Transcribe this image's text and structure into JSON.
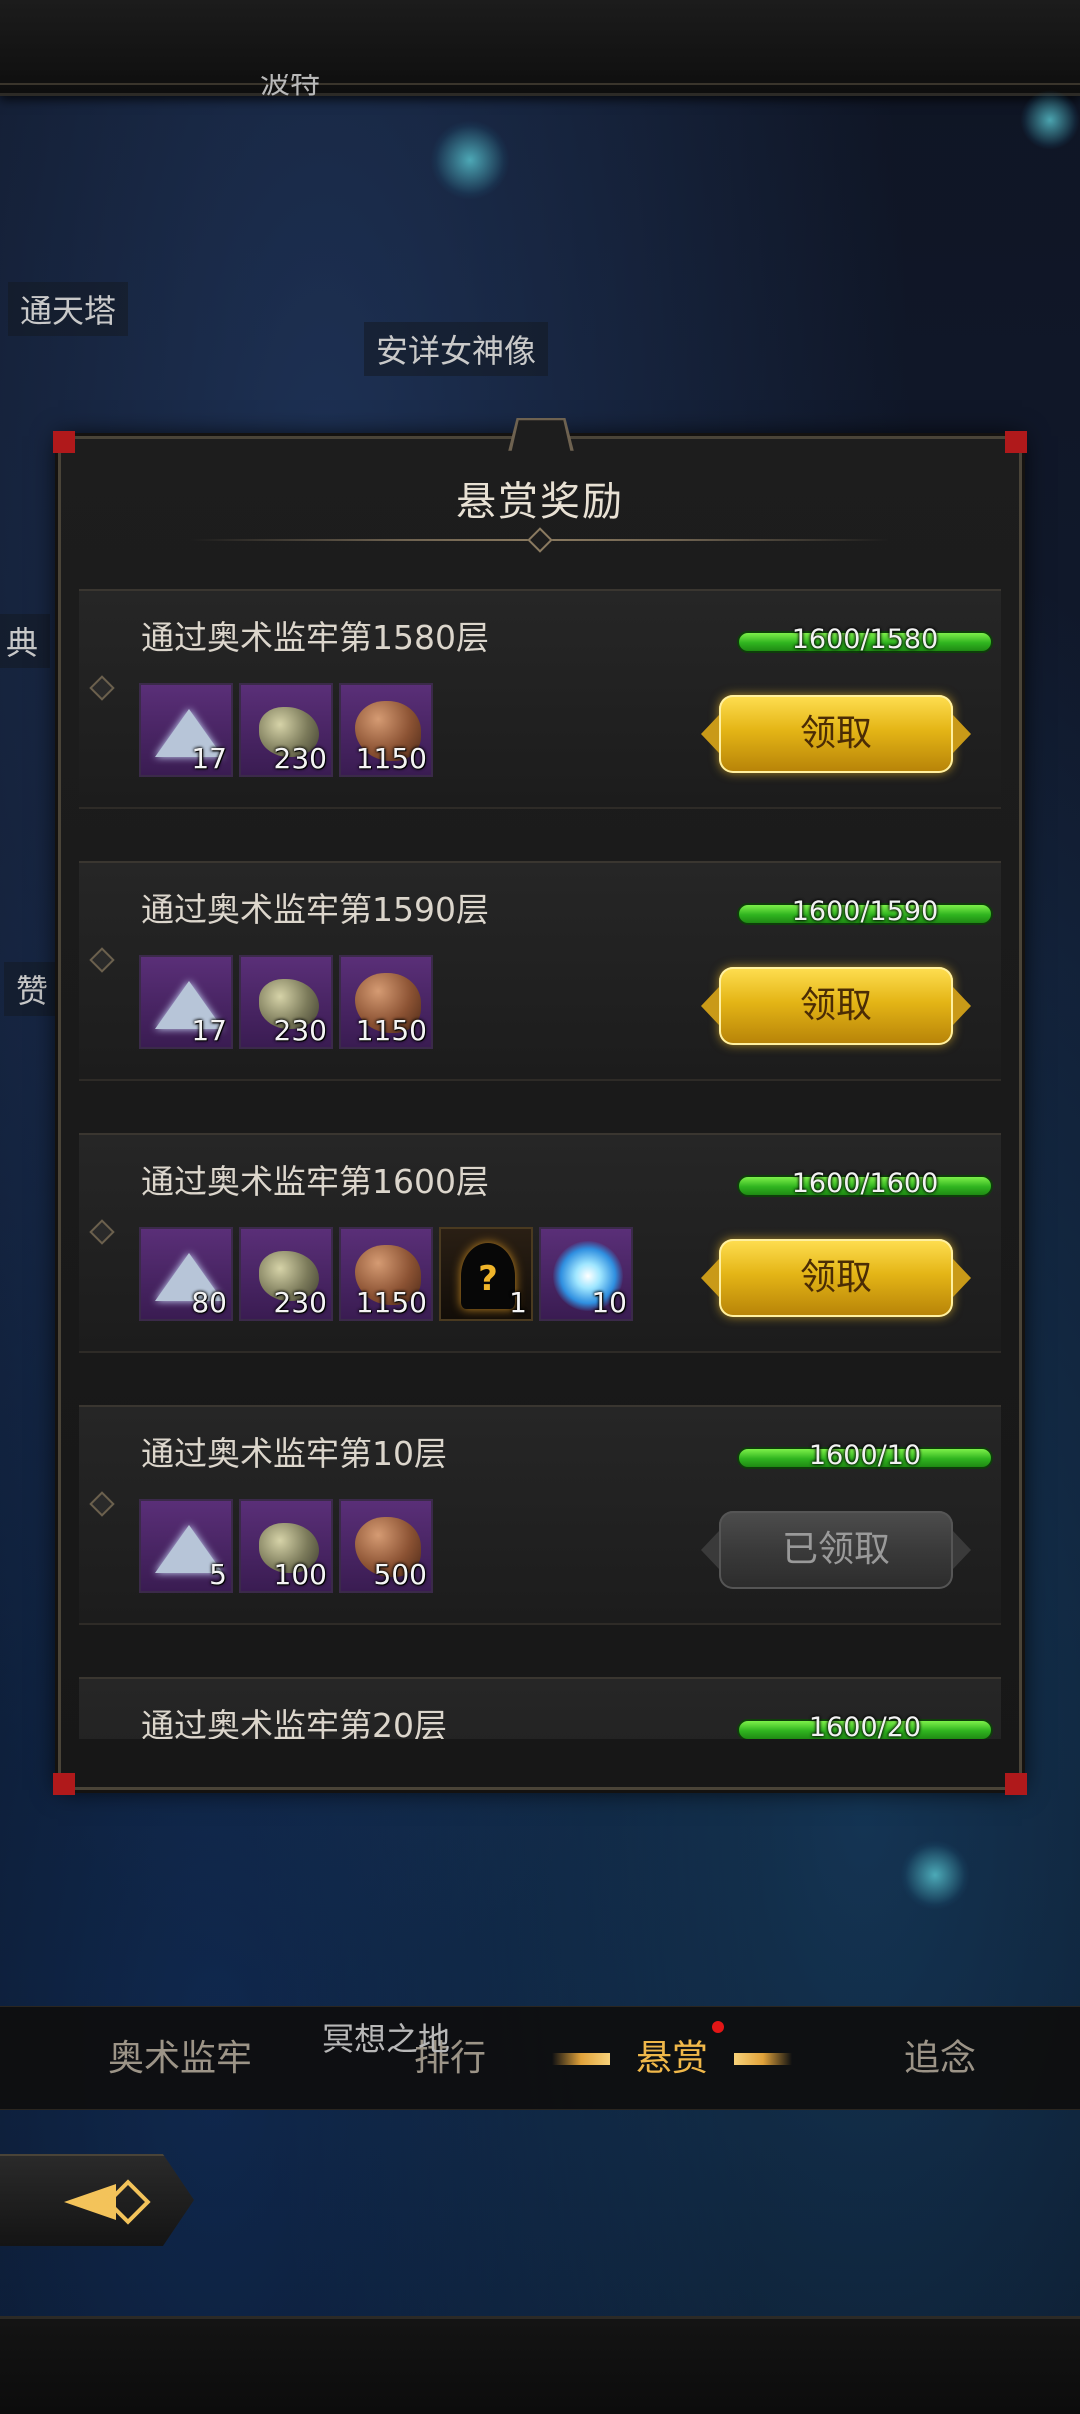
{
  "map_labels": {
    "top_cut": "波特",
    "tower": "通天塔",
    "goddess": "安详女神像",
    "left_edge_1": "典",
    "left_edge_2": "赞",
    "meditation": "冥想之地"
  },
  "panel": {
    "title": "悬赏奖励"
  },
  "quests": [
    {
      "title": "通过奥术监牢第1580层",
      "progress": {
        "current": 1600,
        "target": 1580,
        "label": "1600/1580"
      },
      "rewards": [
        {
          "icon": "crystal-shard-icon",
          "count": "17"
        },
        {
          "icon": "ore-icon",
          "count": "230"
        },
        {
          "icon": "copper-rock-icon",
          "count": "1150"
        }
      ],
      "action": "领取",
      "claimed": false
    },
    {
      "title": "通过奥术监牢第1590层",
      "progress": {
        "current": 1600,
        "target": 1590,
        "label": "1600/1590"
      },
      "rewards": [
        {
          "icon": "crystal-shard-icon",
          "count": "17"
        },
        {
          "icon": "ore-icon",
          "count": "230"
        },
        {
          "icon": "copper-rock-icon",
          "count": "1150"
        }
      ],
      "action": "领取",
      "claimed": false
    },
    {
      "title": "通过奥术监牢第1600层",
      "progress": {
        "current": 1600,
        "target": 1600,
        "label": "1600/1600"
      },
      "rewards": [
        {
          "icon": "crystal-shard-icon",
          "count": "80"
        },
        {
          "icon": "ore-icon",
          "count": "230"
        },
        {
          "icon": "copper-rock-icon",
          "count": "1150"
        },
        {
          "icon": "mystery-box-icon",
          "count": "1"
        },
        {
          "icon": "energy-orb-icon",
          "count": "10"
        }
      ],
      "action": "领取",
      "claimed": false
    },
    {
      "title": "通过奥术监牢第10层",
      "progress": {
        "current": 1600,
        "target": 10,
        "label": "1600/10"
      },
      "rewards": [
        {
          "icon": "crystal-shard-icon",
          "count": "5"
        },
        {
          "icon": "ore-icon",
          "count": "100"
        },
        {
          "icon": "copper-rock-icon",
          "count": "500"
        }
      ],
      "action": "已领取",
      "claimed": true
    },
    {
      "title": "通过奥术监牢第20层",
      "progress": {
        "current": 1600,
        "target": 20,
        "label": "1600/20"
      },
      "rewards": [],
      "action": "",
      "claimed": false
    }
  ],
  "tabs": [
    {
      "label": "奥术监牢",
      "active": false,
      "badge": false
    },
    {
      "label": "排行",
      "active": false,
      "badge": false
    },
    {
      "label": "悬赏",
      "active": true,
      "badge": true
    },
    {
      "label": "追念",
      "active": false,
      "badge": false
    }
  ],
  "colors": {
    "progress_green": "#2fb41f",
    "claim_gold": "#e4b516",
    "active_tab": "#f0b84a",
    "badge_red": "#e21616"
  }
}
